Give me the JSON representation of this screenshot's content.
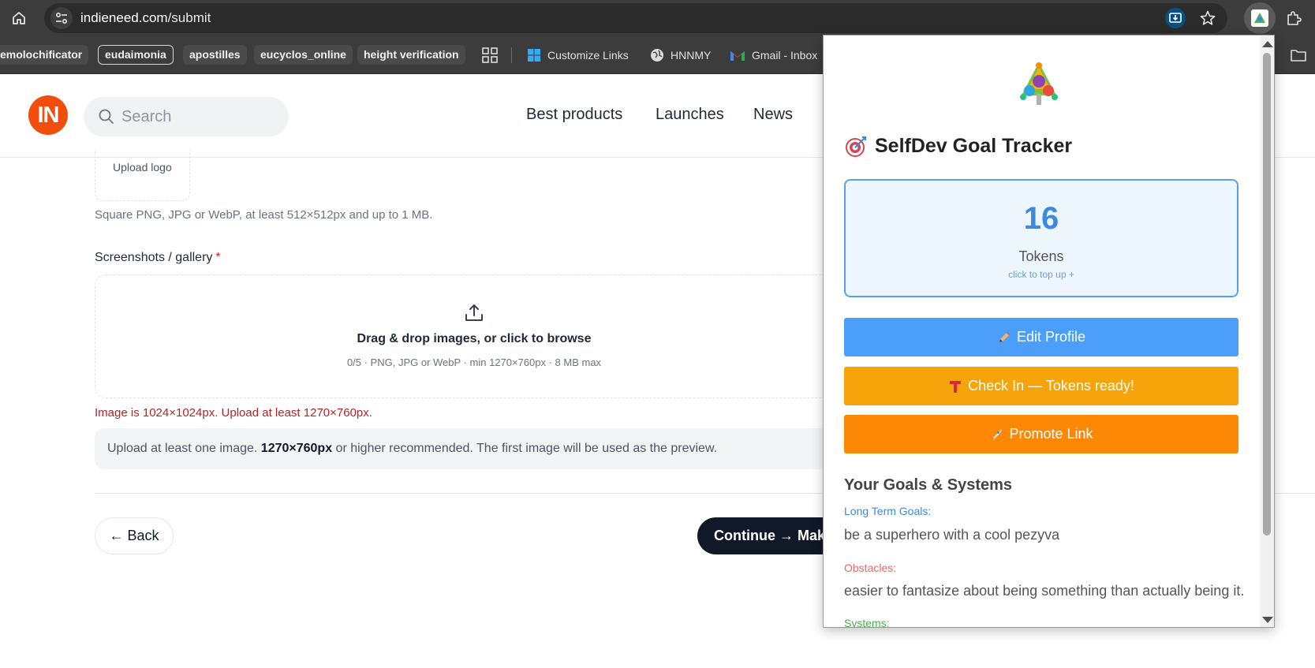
{
  "browser": {
    "url_host": "indieneed.com",
    "url_path": "/submit",
    "bookmarks": [
      {
        "label": "emolochificator",
        "style": "chip"
      },
      {
        "label": "eudaimonia",
        "style": "outlined"
      },
      {
        "label": "apostilles",
        "style": "chip"
      },
      {
        "label": "eucyclos_online",
        "style": "chip"
      },
      {
        "label": "height verification",
        "style": "chip"
      }
    ],
    "bookmark_links": [
      {
        "label": "Customize Links",
        "icon": "windows-icon"
      },
      {
        "label": "HNNMY",
        "icon": "globe-icon"
      },
      {
        "label": "Gmail - Inbox",
        "icon": "gmail-icon"
      }
    ]
  },
  "site": {
    "logo_text": "IN",
    "search_placeholder": "Search",
    "nav": [
      "Best products",
      "Launches",
      "News"
    ]
  },
  "form": {
    "upload_logo_label": "Upload logo",
    "logo_hint": "Square PNG, JPG or WebP, at least 512×512px and up to 1 MB.",
    "gallery_label": "Screenshots / gallery",
    "required_mark": "*",
    "dropzone_title": "Drag & drop images, or click to browse",
    "dropzone_sub": "0/5 · PNG, JPG or WebP · min 1270×760px · 8 MB max",
    "error": "Image is 1024×1024px. Upload at least 1270×760px.",
    "info_prefix": "Upload at least one image. ",
    "info_bold": "1270×760px",
    "info_suffix": " or higher recommended. The first image will be used as the preview.",
    "back_label": "← Back",
    "continue_label": "Continue → Make"
  },
  "popup": {
    "title": "SelfDev Goal Tracker",
    "title_icon": "target-icon",
    "tokens_value": "16",
    "tokens_label": "Tokens",
    "tokens_sub": "click to top up +",
    "edit_profile": "Edit Profile",
    "check_in": "Check In — Tokens ready!",
    "promote": "Promote Link",
    "goals_heading": "Your Goals & Systems",
    "long_term_label": "Long Term Goals:",
    "long_term_text": "be a superhero with a cool pezyva",
    "obstacles_label": "Obstacles:",
    "obstacles_text": "easier to fantasize about being something than actually being it.",
    "systems_label": "Systems:",
    "colors": {
      "blue": "#4b9ef9",
      "amber": "#f6a40a",
      "orange": "#fd8805",
      "label_blue": "#3d89dd",
      "label_red": "#e56b6b",
      "label_green": "#4caf50"
    }
  }
}
